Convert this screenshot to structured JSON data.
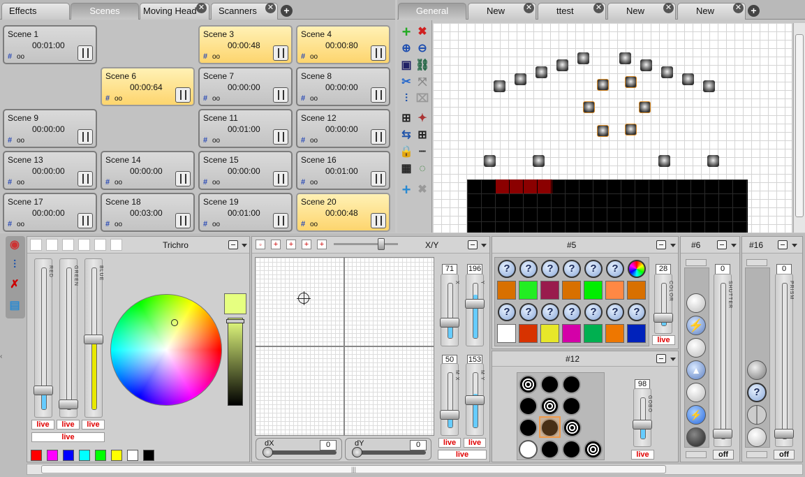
{
  "left_tabs": [
    {
      "label": "Effects",
      "active": false
    },
    {
      "label": "Scenes",
      "active": true
    },
    {
      "label": "Moving Head",
      "active": false,
      "closable": true
    },
    {
      "label": "Scanners",
      "active": false,
      "closable": true
    }
  ],
  "right_tabs": [
    {
      "label": "General",
      "active": true
    },
    {
      "label": "New",
      "active": false
    },
    {
      "label": "ttest",
      "active": false
    },
    {
      "label": "New",
      "active": false
    },
    {
      "label": "New",
      "active": false
    }
  ],
  "scenes": [
    {
      "name": "Scene 1",
      "time": "00:01:00",
      "active": false,
      "badge": "oo"
    },
    {
      "name": "Scene 3",
      "time": "00:00:48",
      "active": true,
      "badge": "oo"
    },
    {
      "name": "Scene 4",
      "time": "00:00:80",
      "active": true,
      "badge": "oo"
    },
    {
      "name": "Scene 6",
      "time": "00:00:64",
      "active": true,
      "badge": "oo"
    },
    {
      "name": "Scene 7",
      "time": "00:00:00",
      "active": false,
      "badge": "oo"
    },
    {
      "name": "Scene 8",
      "time": "00:00:00",
      "active": false,
      "badge": "oo"
    },
    {
      "name": "Scene 9",
      "time": "00:00:00",
      "active": false,
      "badge": "oo"
    },
    {
      "name": "Scene 11",
      "time": "00:01:00",
      "active": false,
      "badge": "oo"
    },
    {
      "name": "Scene 12",
      "time": "00:00:00",
      "active": false,
      "badge": "oo"
    },
    {
      "name": "Scene 13",
      "time": "00:00:00",
      "active": false,
      "badge": "oo"
    },
    {
      "name": "Scene 14",
      "time": "00:00:00",
      "active": false,
      "badge": "oo"
    },
    {
      "name": "Scene 15",
      "time": "00:00:00",
      "active": false,
      "badge": "oo"
    },
    {
      "name": "Scene 16",
      "time": "00:01:00",
      "active": false,
      "badge": "oo"
    },
    {
      "name": "Scene 17",
      "time": "00:00:00",
      "active": false,
      "badge": "oo"
    },
    {
      "name": "Scene 18",
      "time": "00:03:00",
      "active": false,
      "badge": "oo"
    },
    {
      "name": "Scene 19",
      "time": "00:01:00",
      "active": false,
      "badge": "oo"
    },
    {
      "name": "Scene 20",
      "time": "00:00:48",
      "active": true,
      "badge": "oo"
    }
  ],
  "color_panel": {
    "title": "Trichro",
    "red": {
      "label": "RED",
      "value": "29",
      "live": "live",
      "level": 0.11
    },
    "green": {
      "label": "GREEN",
      "value": "0",
      "live": "live",
      "level": 0.0
    },
    "blue": {
      "label": "BLUE",
      "value": "133",
      "live": "live",
      "level": 0.52
    },
    "master_live": "live",
    "preview_color": "#e6ff80",
    "palette": [
      "#ff0000",
      "#ff00ff",
      "#0000ff",
      "#00ffff",
      "#00ff00",
      "#ffff00",
      "#ffffff",
      "#000000"
    ]
  },
  "xy_panel": {
    "title": "X/Y",
    "x": {
      "label": "X",
      "value": "71",
      "live": "live",
      "level": 0.28
    },
    "y": {
      "label": "Y",
      "value": "196",
      "live": "live",
      "level": 0.77
    },
    "mx": {
      "label": "M X",
      "value": "50",
      "level": 0.2
    },
    "my": {
      "label": "M Y",
      "value": "153",
      "level": 0.6
    },
    "master_live": "live",
    "dx": {
      "label": "dX",
      "value": "0"
    },
    "dy": {
      "label": "dY",
      "value": "0"
    }
  },
  "color_wheel_panel": {
    "title": "#5",
    "color_label": "COLOR",
    "value": "28",
    "live": "live",
    "level": 0.11,
    "swatches_row1": [
      "#d87000",
      "#22ee22",
      "#991b4d",
      "#d87000",
      "#00ee00",
      "#ff8844",
      "#d87000"
    ],
    "swatches_row2": [
      "#ffffff",
      "#d73300",
      "#e7e72a",
      "#d400a8",
      "#00b050",
      "#ee7700",
      "#0022bb"
    ]
  },
  "gobo_panel": {
    "title": "#12",
    "gobo_label": "GOBO",
    "value": "98",
    "live": "live",
    "level": 0.38
  },
  "shutter_panel": {
    "title": "#6",
    "label": "SHUTTER",
    "value": "0",
    "off": "off",
    "level": 0.0
  },
  "prism_panel": {
    "title": "#16",
    "label": "PRISM",
    "value": "0",
    "off": "off",
    "level": 0.0
  },
  "status": {
    "scroll": "|||"
  }
}
